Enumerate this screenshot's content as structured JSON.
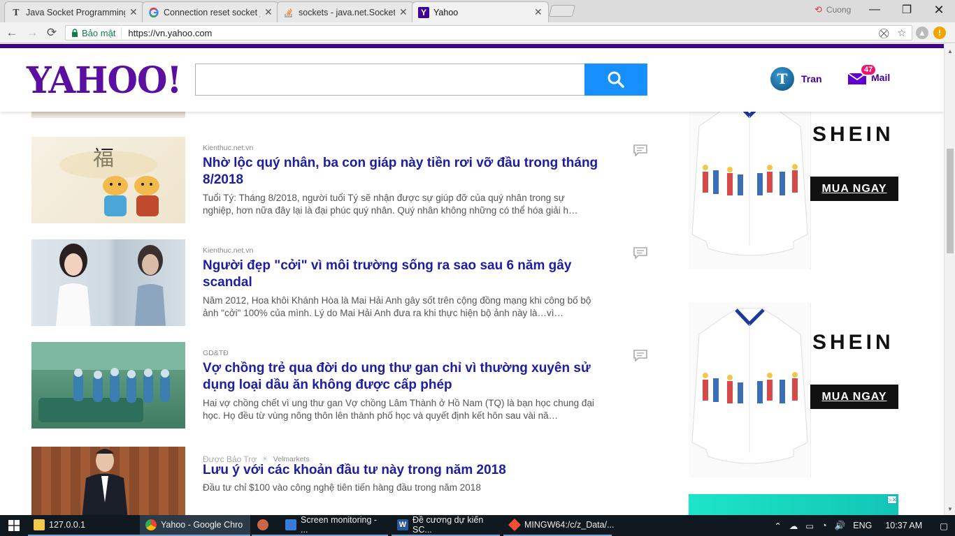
{
  "browser": {
    "tabs": [
      {
        "title": "Java Socket Programming",
        "favicon": "T",
        "active": false
      },
      {
        "title": "Connection reset socket j",
        "favicon": "G",
        "active": false
      },
      {
        "title": "sockets - java.net.Socket",
        "favicon": "stackoverflow-icon",
        "active": false
      },
      {
        "title": "Yahoo",
        "favicon": "Y",
        "active": true
      }
    ],
    "user_name": "Cuong",
    "secure_label": "Bảo mật",
    "url": "https://vn.yahoo.com"
  },
  "header": {
    "logo": "YAHOO!",
    "search_placeholder": "",
    "user": {
      "initial": "T",
      "name": "Tran"
    },
    "mail": {
      "label": "Mail",
      "count": "47"
    }
  },
  "stories": [
    {
      "provider": "Kienthuc.net.vn",
      "headline": "Nhờ lộc quý nhân, ba con giáp này tiền rơi vỡ đầu trong tháng 8/2018",
      "summary": "Tuổi Tý: Tháng 8/2018, người tuổi Tý sẽ nhận được sự giúp đỡ của quý nhân trong sự nghiệp, hơn nữa đây lại là đại phúc quý nhân. Quý nhân không những có thể hóa giải h…",
      "thumb_char": "福"
    },
    {
      "provider": "Kienthuc.net.vn",
      "headline": "Người đẹp \"cởi\" vì môi trường sống ra sao sau 6 năm gây scandal",
      "summary": "Năm 2012, Hoa khôi Khánh Hòa là Mai Hải Anh gây sốt trên cộng đồng mạng khi công bố bộ ảnh \"cởi\" 100% của mình. Lý do Mai Hải Anh đưa ra khi thực hiện bộ ảnh này là…vì…"
    },
    {
      "provider": "GD&TĐ",
      "headline": "Vợ chồng trẻ qua đời do ung thư gan chỉ vì thường xuyên sử dụng loại dầu ăn không được cấp phép",
      "summary": "Hai vợ chồng chết vì ung thư gan Vợ chồng Lâm Thành ở Hồ Nam (TQ) là bạn học chung đại học. Họ đều từ vùng nông thôn lên thành phố học và quyết định kết hôn sau vài nă…"
    },
    {
      "sponsored_label": "Được Bảo Trợ",
      "provider": "Velmarkets",
      "headline": "Lưu ý với các khoản đầu tư này trong năm 2018",
      "summary": "Đầu tư chỉ $100 vào công nghệ tiên tiến hàng đầu trong năm 2018"
    }
  ],
  "ads": {
    "brand": "SHEIN",
    "cta": "MUA NGAY",
    "info": "i",
    "close": "▷✕"
  },
  "taskbar": {
    "items": [
      {
        "label": "127.0.0.1",
        "icon": "folder-icon"
      },
      {
        "label": "Yahoo - Google Chro",
        "icon": "chrome-icon"
      },
      {
        "label": "",
        "icon": "app-icon"
      },
      {
        "label": "Screen monitoring - ...",
        "icon": "box-icon"
      },
      {
        "label": "Đề cương dự kiến SC...",
        "icon": "word-icon"
      },
      {
        "label": "MINGW64:/c/z_Data/...",
        "icon": "git-icon"
      }
    ],
    "language": "ENG",
    "time": "10:37 AM"
  },
  "colors": {
    "yahoo_purple": "#400090",
    "search_blue": "#188fff",
    "headline_blue": "#1d1da3",
    "mail_badge": "#f0156e"
  }
}
